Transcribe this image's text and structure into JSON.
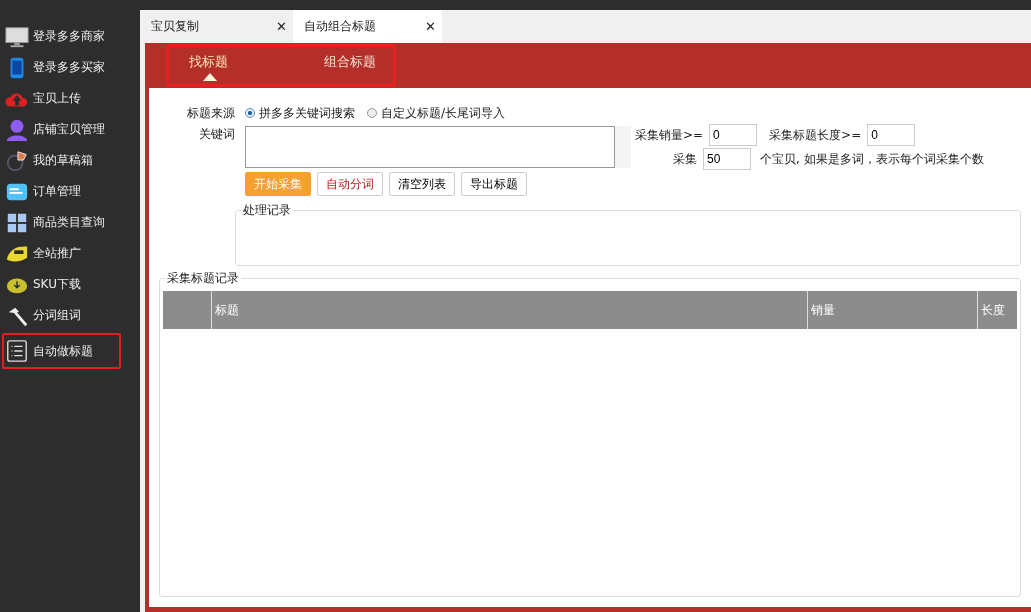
{
  "sidebar": {
    "items": [
      {
        "label": "登录多多商家",
        "selected": false
      },
      {
        "label": "登录多多买家",
        "selected": false
      },
      {
        "label": "宝贝上传",
        "selected": false
      },
      {
        "label": "店铺宝贝管理",
        "selected": false
      },
      {
        "label": "我的草稿箱",
        "selected": false
      },
      {
        "label": "订单管理",
        "selected": false
      },
      {
        "label": "商品类目查询",
        "selected": false
      },
      {
        "label": "全站推广",
        "selected": false
      },
      {
        "label": "SKU下载",
        "selected": false
      },
      {
        "label": "分词组词",
        "selected": false
      },
      {
        "label": "自动做标题",
        "selected": true
      }
    ]
  },
  "tabs": [
    {
      "label": "宝贝复制",
      "selected": false,
      "close": "✕"
    },
    {
      "label": "自动组合标题",
      "selected": true,
      "close": "✕"
    }
  ],
  "subtabs": [
    {
      "label": "找标题",
      "selected": true
    },
    {
      "label": "组合标题",
      "selected": false
    }
  ],
  "form": {
    "source_label": "标题来源",
    "source_options": [
      {
        "label": "拼多多关键词搜索",
        "selected": true
      },
      {
        "label": "自定义标题/长尾词导入",
        "selected": false
      }
    ],
    "keyword_label": "关键词",
    "sales_label": "采集销量>=",
    "sales_value": "0",
    "title_length_label": "采集标题长度>=",
    "title_length_value": "0",
    "collect_label": "采集",
    "collect_value": "50",
    "collect_note": "个宝贝, 如果是多词，表示每个词采集个数",
    "buttons": [
      {
        "label": "开始采集",
        "kind": "primary"
      },
      {
        "label": "自动分词",
        "kind": "danger"
      },
      {
        "label": "清空列表",
        "kind": "plain"
      },
      {
        "label": "导出标题",
        "kind": "plain"
      }
    ],
    "log_label": "处理记录"
  },
  "table": {
    "title": "采集标题记录",
    "columns": [
      {
        "label": "标题"
      },
      {
        "label": "销量"
      },
      {
        "label": "长度"
      }
    ]
  }
}
